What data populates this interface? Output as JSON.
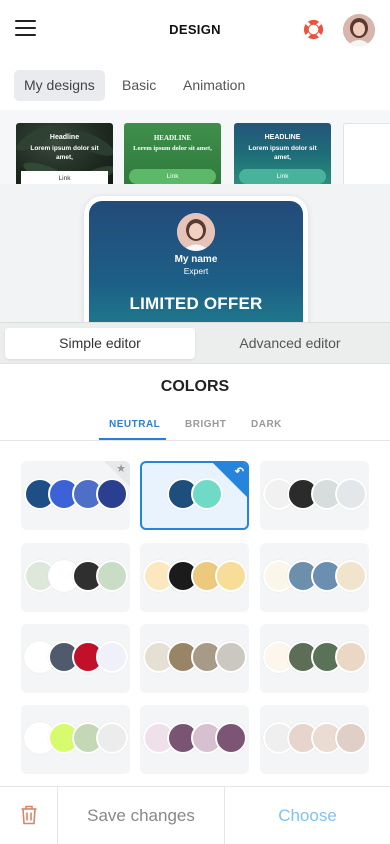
{
  "header": {
    "title": "DESIGN",
    "menu_icon": "hamburger-menu-icon",
    "help_icon": "lifebuoy-icon",
    "avatar": "user-avatar"
  },
  "design_tabs": [
    {
      "label": "My designs",
      "active": true
    },
    {
      "label": "Basic",
      "active": false
    },
    {
      "label": "Animation",
      "active": false
    }
  ],
  "templates": [
    {
      "headline": "Headline",
      "body": "Lorem ipsum dolor sit amet,",
      "link": "Link"
    },
    {
      "headline": "HEADLINE",
      "body": "Lorem ipsum dolor sit amet,",
      "link": "Link"
    },
    {
      "headline": "HEADLINE",
      "body": "Lorem ipsum dolor sit amet,",
      "link": "Link"
    }
  ],
  "preview": {
    "name": "My name",
    "role": "Expert",
    "offer": "LIMITED OFFER"
  },
  "editor_modes": [
    {
      "label": "Simple editor",
      "active": true
    },
    {
      "label": "Advanced editor",
      "active": false
    }
  ],
  "colors": {
    "title": "COLORS",
    "tabs": [
      {
        "label": "NEUTRAL",
        "active": true
      },
      {
        "label": "BRIGHT",
        "active": false
      },
      {
        "label": "DARK",
        "active": false
      }
    ],
    "palettes": [
      {
        "swatches": [
          "#1d4e86",
          "#3d62d8",
          "#4e6fc8",
          "#2a3f8f"
        ],
        "badge": "star"
      },
      {
        "swatches": [
          "#1e4f7c",
          "#6fdac6"
        ],
        "badge": "selected"
      },
      {
        "swatches": [
          "#f1f1f1",
          "#2b2b2b",
          "#d7dcdd",
          "#e4e7ea"
        ],
        "badge": ""
      },
      {
        "swatches": [
          "#dde8da",
          "#ffffff",
          "#2f2f2f",
          "#c8dcc6"
        ],
        "badge": ""
      },
      {
        "swatches": [
          "#fbe8bf",
          "#1b1b1b",
          "#ecc97c",
          "#f7dd98"
        ],
        "badge": ""
      },
      {
        "swatches": [
          "#fbf6ea",
          "#6c8fae",
          "#6a8fb0",
          "#f0e4cc"
        ],
        "badge": ""
      },
      {
        "swatches": [
          "#ffffff",
          "#505a6c",
          "#c0102a",
          "#f0f0fb"
        ],
        "badge": ""
      },
      {
        "swatches": [
          "#e6e0d4",
          "#9a8466",
          "#a79a86",
          "#cbc8c1"
        ],
        "badge": ""
      },
      {
        "swatches": [
          "#fcf6ec",
          "#5c6f56",
          "#5a7257",
          "#ead8c4"
        ],
        "badge": ""
      },
      {
        "swatches": [
          "#ffffff",
          "#d6fb6e",
          "#c4d8b6",
          "#ececec"
        ],
        "badge": ""
      },
      {
        "swatches": [
          "#efe0ea",
          "#7a5473",
          "#d7c0cf",
          "#7b5573"
        ],
        "badge": ""
      },
      {
        "swatches": [
          "#efefef",
          "#e7d5cd",
          "#eadbd3",
          "#e0cfc6"
        ],
        "badge": ""
      }
    ]
  },
  "bottom": {
    "delete_icon": "trash-icon",
    "save_label": "Save changes",
    "choose_label": "Choose"
  },
  "accent_color": "#2485db"
}
